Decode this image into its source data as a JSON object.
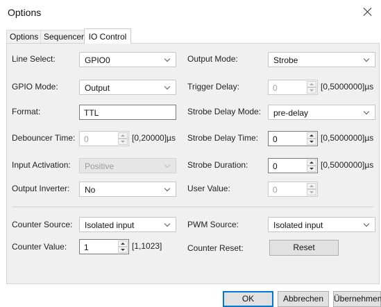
{
  "window": {
    "title": "Options"
  },
  "tabs": [
    {
      "label": "Options"
    },
    {
      "label": "Sequencer"
    },
    {
      "label": "IO Control"
    }
  ],
  "left": {
    "line_select": {
      "label": "Line Select:",
      "value": "GPIO0"
    },
    "gpio_mode": {
      "label": "GPIO Mode:",
      "value": "Output"
    },
    "format": {
      "label": "Format:",
      "value": "TTL"
    },
    "debouncer_time": {
      "label": "Debouncer Time:",
      "value": "0",
      "range": "[0,20000]µs"
    },
    "input_activation": {
      "label": "Input Activation:",
      "value": "Positive"
    },
    "output_inverter": {
      "label": "Output Inverter:",
      "value": "No"
    },
    "counter_source": {
      "label": "Counter Source:",
      "value": "Isolated input"
    },
    "counter_value": {
      "label": "Counter Value:",
      "value": "1",
      "range": "[1,1023]"
    }
  },
  "right": {
    "output_mode": {
      "label": "Output Mode:",
      "value": "Strobe"
    },
    "trigger_delay": {
      "label": "Trigger Delay:",
      "value": "0",
      "range": "[0,5000000]µs"
    },
    "strobe_delay_mode": {
      "label": "Strobe Delay Mode:",
      "value": "pre-delay"
    },
    "strobe_delay_time": {
      "label": "Strobe Delay Time:",
      "value": "0",
      "range": "[0,5000000]µs"
    },
    "strobe_duration": {
      "label": "Strobe Duration:",
      "value": "0",
      "range": "[0,5000000]µs"
    },
    "user_value": {
      "label": "User Value:",
      "value": "0"
    },
    "pwm_source": {
      "label": "PWM Source:",
      "value": "Isolated input"
    },
    "counter_reset": {
      "label": "Counter Reset:",
      "button": "Reset"
    }
  },
  "footer": {
    "ok": "OK",
    "cancel": "Abbrechen",
    "apply": "Übernehmen"
  }
}
